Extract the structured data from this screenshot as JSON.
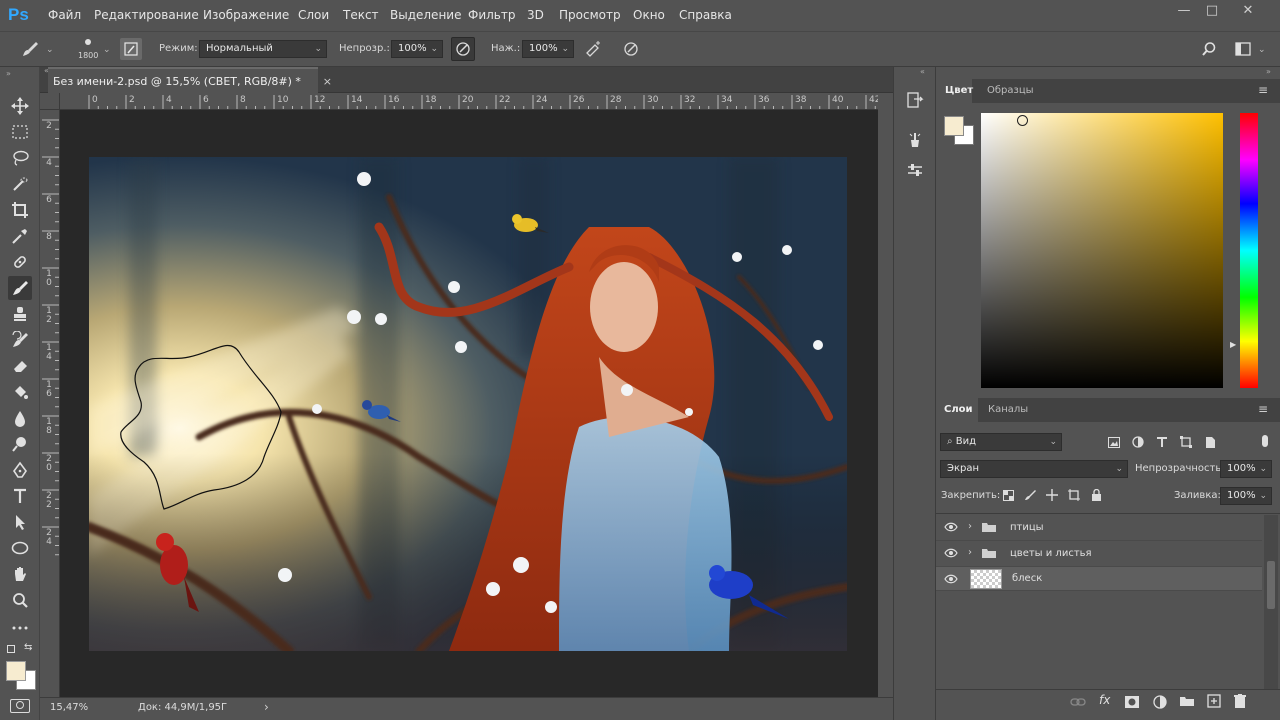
{
  "app": {
    "logo": "Ps"
  },
  "menu": [
    "Файл",
    "Редактирование",
    "Изображение",
    "Слои",
    "Текст",
    "Выделение",
    "Фильтр",
    "3D",
    "Просмотр",
    "Окно",
    "Справка"
  ],
  "window_controls": {
    "minimize": "—",
    "restore": "□",
    "close": "✕"
  },
  "options": {
    "brush_size": "1800",
    "mode_label": "Режим:",
    "mode_value": "Нормальный",
    "opacity_label": "Непрозр.:",
    "opacity_value": "100%",
    "pressure_label": "Наж.:",
    "pressure_value": "100%"
  },
  "document": {
    "tab_title": "Без имени-2.psd @ 15,5% (СВЕТ, RGB/8#) *",
    "tab_close": "×",
    "hruler_ticks": [
      "0",
      "2",
      "4",
      "6",
      "8",
      "10",
      "12",
      "14",
      "16",
      "18",
      "20",
      "22",
      "24",
      "26",
      "28",
      "30",
      "32",
      "34",
      "36",
      "38",
      "40",
      "42"
    ],
    "vruler_ticks": [
      "2",
      "4",
      "6",
      "8",
      "1 0",
      "1 2",
      "1 4",
      "1 6",
      "1 8",
      "2 0",
      "2 2",
      "2 4"
    ],
    "status_zoom": "15,47%",
    "status_doc": "Док: 44,9M/1,95Г",
    "status_arrow": "›"
  },
  "color_panel": {
    "tabs": [
      "Цвет",
      "Образцы"
    ],
    "foreground": "#f7ecd0",
    "background": "#ffffff",
    "hue_base": "#ffc000"
  },
  "layers_panel": {
    "tabs": [
      "Слои",
      "Каналы"
    ],
    "filter_label": "Вид",
    "blend_mode": "Экран",
    "opacity_label": "Непрозрачность:",
    "opacity_value": "100%",
    "lock_label": "Закрепить:",
    "fill_label": "Заливка:",
    "fill_value": "100%",
    "layers": [
      {
        "name": "птицы",
        "type": "group"
      },
      {
        "name": "цветы и листья",
        "type": "group"
      },
      {
        "name": "блеск",
        "type": "pixel"
      }
    ]
  },
  "colors": {
    "accent": "#31a8ff",
    "panel": "#535353",
    "dark": "#282828"
  }
}
